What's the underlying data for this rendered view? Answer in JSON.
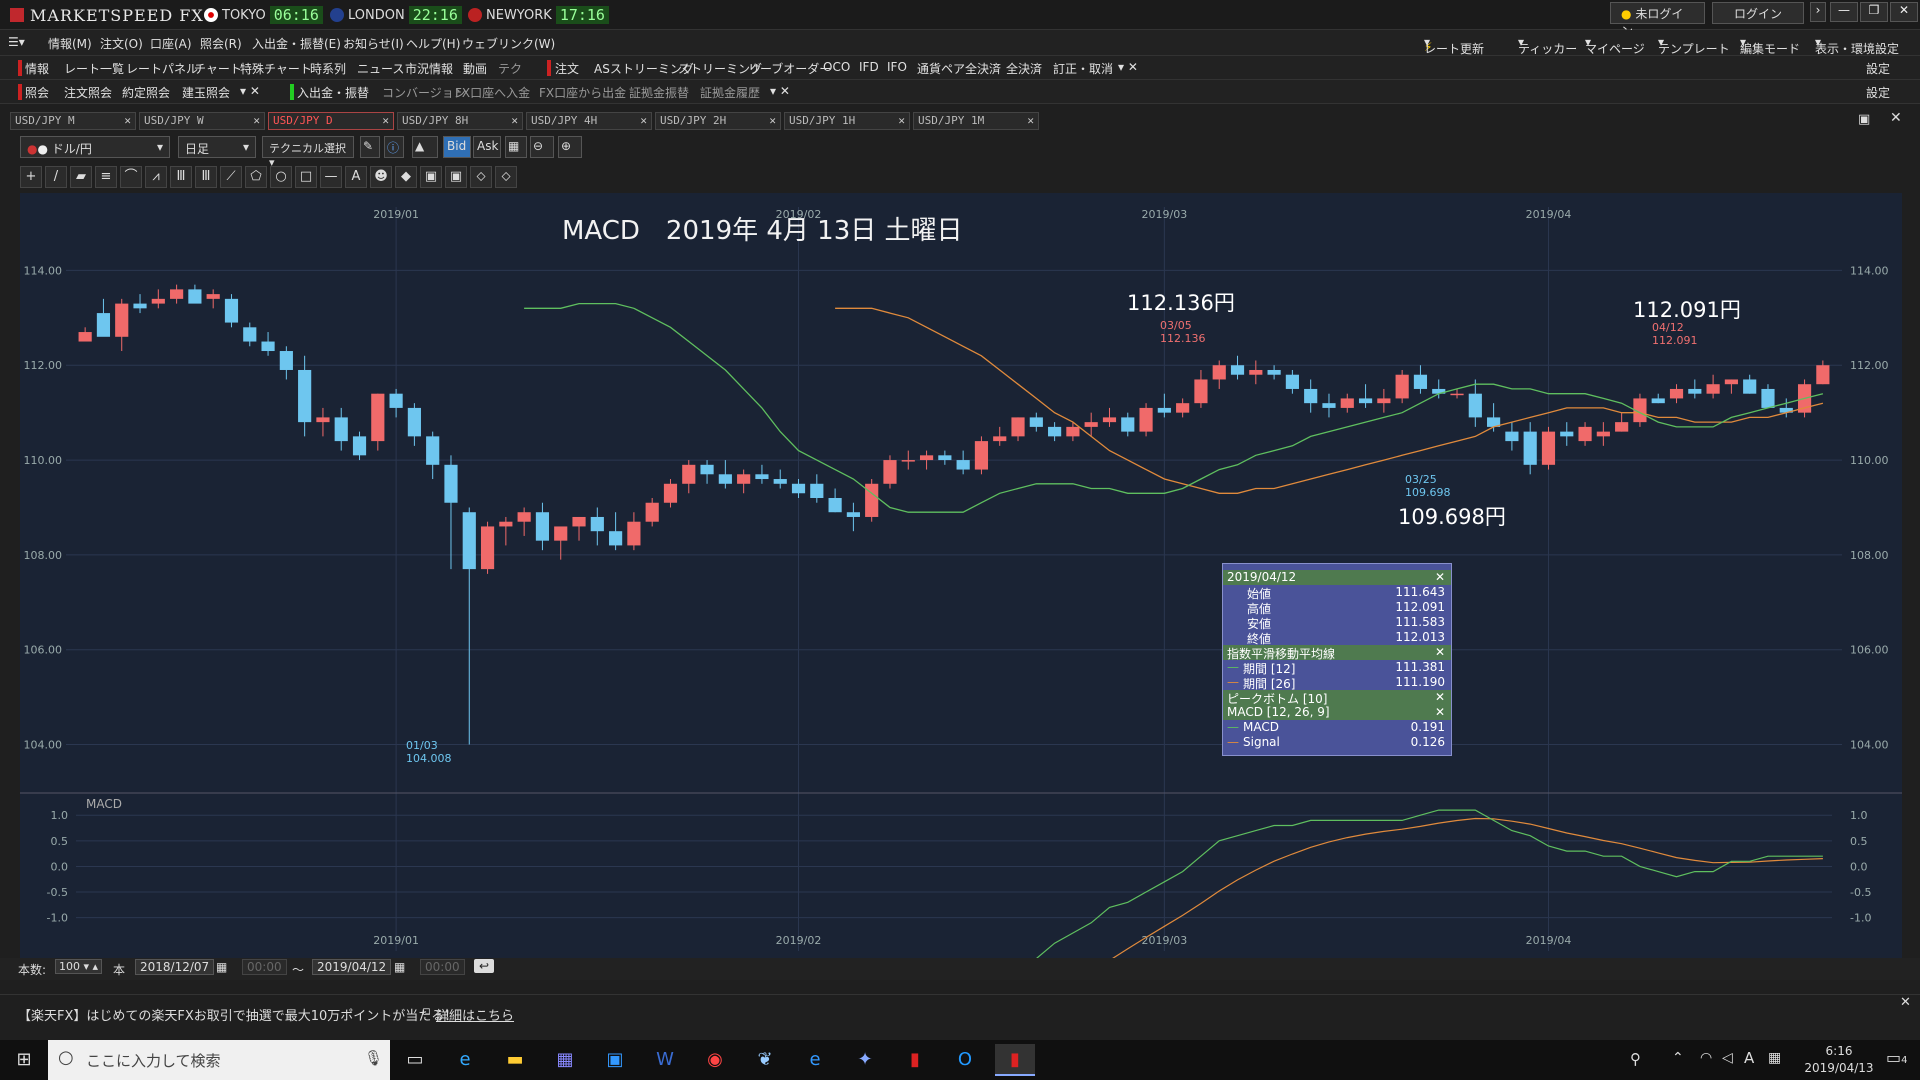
{
  "app": {
    "brand": "MARKETSPEED FX",
    "login_status": "未ログイン",
    "login_button": "ログイン"
  },
  "clocks": [
    {
      "city": "TOKYO",
      "time": "06:16"
    },
    {
      "city": "LONDON",
      "time": "22:16"
    },
    {
      "city": "NEWYORK",
      "time": "17:16"
    }
  ],
  "menubar": [
    "情報(M)",
    "注文(O)",
    "口座(A)",
    "照会(R)",
    "入出金・振替(E)",
    "お知らせ(I)",
    "ヘルプ(H)",
    "ウェブリンク(W)"
  ],
  "menubar_right": [
    "レート更新",
    "ティッカー",
    "マイページ",
    "テンプレート",
    "編集モード",
    "表示・環境設定"
  ],
  "toolbar1": [
    "情報",
    "レート一覧",
    "レートパネル",
    "チャート",
    "特殊チャート",
    "時系列",
    "ニュース",
    "市況情報",
    "動画",
    "テク",
    "注文",
    "ASストリーミング",
    "ストリーミング",
    "リーブオーダー",
    "OCO",
    "IFD",
    "IFO",
    "通貨ペア全決済",
    "全決済",
    "訂正・取消"
  ],
  "toolbar1_right": "設定",
  "toolbar2": [
    "照会",
    "注文照会",
    "約定照会",
    "建玉照会",
    "入出金・振替",
    "コンバージョン",
    "FX口座へ入金",
    "FX口座から出金",
    "証拠金振替",
    "証拠金履歴"
  ],
  "toolbar2_right": "設定",
  "tabs": [
    "USD/JPY M",
    "USD/JPY W",
    "USD/JPY D",
    "USD/JPY 8H",
    "USD/JPY 4H",
    "USD/JPY 2H",
    "USD/JPY 1H",
    "USD/JPY 1M"
  ],
  "active_tab": 2,
  "controls": {
    "pair": "ドル/円",
    "period": "日足",
    "technical": "テクニカル選択",
    "bid": "Bid",
    "ask": "Ask"
  },
  "overlay_title": "MACD　2019年 4月 13日 土曜日",
  "annotations": {
    "high": {
      "price": "112.136円",
      "date": "03/05",
      "value": "112.136"
    },
    "last": {
      "price": "112.091円",
      "date": "04/12",
      "value": "112.091"
    },
    "low_mar": {
      "price": "109.698円",
      "date": "03/25",
      "value": "109.698"
    },
    "low_jan": {
      "date": "01/03",
      "value": "104.008"
    }
  },
  "info_box": {
    "date": "2019/04/12",
    "ohlc": [
      {
        "label": "始値",
        "value": "111.643"
      },
      {
        "label": "高値",
        "value": "112.091"
      },
      {
        "label": "安値",
        "value": "111.583"
      },
      {
        "label": "終値",
        "value": "112.013"
      }
    ],
    "ema_title": "指数平滑移動平均線",
    "ema": [
      {
        "label": "期間 [12]",
        "value": "111.381"
      },
      {
        "label": "期間 [26]",
        "value": "111.190"
      }
    ],
    "peak_title": "ピークボトム [10]",
    "macd_title": "MACD [12, 26, 9]",
    "macd": [
      {
        "label": "MACD",
        "value": "0.191"
      },
      {
        "label": "Signal",
        "value": "0.126"
      }
    ]
  },
  "macd_label": "MACD",
  "status": {
    "count_label": "本数:",
    "count": "100",
    "unit": "本",
    "from": "2018/12/07",
    "time1": "00:00",
    "tilde": "～",
    "to": "2019/04/12",
    "time2": "00:00"
  },
  "ad": {
    "text": "【楽天FX】はじめての楽天FXお取引で抽選で最大10万ポイントが当たる！",
    "link": "詳細はこちら"
  },
  "taskbar": {
    "search": "ここに入力して検索",
    "time": "6:16",
    "date": "2019/04/13",
    "notif": "4"
  },
  "colors": {
    "up": "#f06a6a",
    "down": "#6ec6ef",
    "ema12": "#5fbf5f",
    "ema26": "#e08a3c",
    "bg": "#1a2334"
  },
  "chart_data": {
    "type": "candlestick",
    "ylim": [
      103.4,
      115.0
    ],
    "yticks": [
      "114.00",
      "112.00",
      "110.00",
      "108.00",
      "106.00",
      "104.00"
    ],
    "xticks": [
      {
        "label": "2019/01",
        "index": 17
      },
      {
        "label": "2019/02",
        "index": 39
      },
      {
        "label": "2019/03",
        "index": 59
      },
      {
        "label": "2019/04",
        "index": 80
      }
    ],
    "candles": [
      [
        112.5,
        112.8,
        112.6,
        112.7
      ],
      [
        113.1,
        113.4,
        113.0,
        112.6
      ],
      [
        112.6,
        113.4,
        112.3,
        113.3
      ],
      [
        113.3,
        113.5,
        113.1,
        113.2
      ],
      [
        113.3,
        113.6,
        113.2,
        113.4
      ],
      [
        113.4,
        113.7,
        113.3,
        113.6
      ],
      [
        113.6,
        113.7,
        113.4,
        113.3
      ],
      [
        113.4,
        113.6,
        113.2,
        113.5
      ],
      [
        113.4,
        113.5,
        112.8,
        112.9
      ],
      [
        112.8,
        112.9,
        112.4,
        112.5
      ],
      [
        112.5,
        112.7,
        112.2,
        112.3
      ],
      [
        112.3,
        112.4,
        111.7,
        111.9
      ],
      [
        111.9,
        112.2,
        110.5,
        110.8
      ],
      [
        110.8,
        111.1,
        110.5,
        110.9
      ],
      [
        110.9,
        111.1,
        110.2,
        110.4
      ],
      [
        110.5,
        110.6,
        110.0,
        110.1
      ],
      [
        110.4,
        111.4,
        110.2,
        111.4
      ],
      [
        111.4,
        111.5,
        110.9,
        111.1
      ],
      [
        111.1,
        111.2,
        110.3,
        110.5
      ],
      [
        110.5,
        110.6,
        109.6,
        109.9
      ],
      [
        109.9,
        110.1,
        107.7,
        109.1
      ],
      [
        108.9,
        109.0,
        104.0,
        107.7
      ],
      [
        107.7,
        108.7,
        107.6,
        108.6
      ],
      [
        108.6,
        108.8,
        108.2,
        108.7
      ],
      [
        108.7,
        109.0,
        108.4,
        108.9
      ],
      [
        108.9,
        109.1,
        108.1,
        108.3
      ],
      [
        108.3,
        108.5,
        107.9,
        108.6
      ],
      [
        108.6,
        108.8,
        108.3,
        108.8
      ],
      [
        108.8,
        109.0,
        108.2,
        108.5
      ],
      [
        108.5,
        108.9,
        108.1,
        108.2
      ],
      [
        108.2,
        108.9,
        108.1,
        108.7
      ],
      [
        108.7,
        109.2,
        108.6,
        109.1
      ],
      [
        109.1,
        109.6,
        109.0,
        109.5
      ],
      [
        109.5,
        110.0,
        109.3,
        109.9
      ],
      [
        109.9,
        110.0,
        109.5,
        109.7
      ],
      [
        109.7,
        110.0,
        109.4,
        109.5
      ],
      [
        109.5,
        109.8,
        109.3,
        109.7
      ],
      [
        109.7,
        109.9,
        109.5,
        109.6
      ],
      [
        109.6,
        109.8,
        109.4,
        109.5
      ],
      [
        109.5,
        109.6,
        109.2,
        109.3
      ],
      [
        109.5,
        109.7,
        109.1,
        109.2
      ],
      [
        109.2,
        109.4,
        108.9,
        108.9
      ],
      [
        108.9,
        109.1,
        108.5,
        108.8
      ],
      [
        108.8,
        109.6,
        108.7,
        109.5
      ],
      [
        109.5,
        110.1,
        109.4,
        110.0
      ],
      [
        110.0,
        110.2,
        109.8,
        110.0
      ],
      [
        110.0,
        110.2,
        109.8,
        110.1
      ],
      [
        110.1,
        110.2,
        109.9,
        110.0
      ],
      [
        110.0,
        110.2,
        109.7,
        109.8
      ],
      [
        109.8,
        110.5,
        109.7,
        110.4
      ],
      [
        110.4,
        110.7,
        110.3,
        110.5
      ],
      [
        110.5,
        110.9,
        110.4,
        110.9
      ],
      [
        110.9,
        111.0,
        110.6,
        110.7
      ],
      [
        110.7,
        110.8,
        110.4,
        110.5
      ],
      [
        110.5,
        110.8,
        110.4,
        110.7
      ],
      [
        110.7,
        111.0,
        110.5,
        110.8
      ],
      [
        110.8,
        111.1,
        110.7,
        110.9
      ],
      [
        110.9,
        111.0,
        110.5,
        110.6
      ],
      [
        110.6,
        111.2,
        110.5,
        111.1
      ],
      [
        111.1,
        111.4,
        110.9,
        111.0
      ],
      [
        111.0,
        111.3,
        110.9,
        111.2
      ],
      [
        111.2,
        111.9,
        111.1,
        111.7
      ],
      [
        111.7,
        112.1,
        111.5,
        112.0
      ],
      [
        112.0,
        112.2,
        111.7,
        111.8
      ],
      [
        111.8,
        112.1,
        111.6,
        111.9
      ],
      [
        111.9,
        112.0,
        111.7,
        111.8
      ],
      [
        111.8,
        111.9,
        111.4,
        111.5
      ],
      [
        111.5,
        111.7,
        111.0,
        111.2
      ],
      [
        111.2,
        111.4,
        110.9,
        111.1
      ],
      [
        111.1,
        111.4,
        111.0,
        111.3
      ],
      [
        111.3,
        111.6,
        111.1,
        111.2
      ],
      [
        111.2,
        111.5,
        111.0,
        111.3
      ],
      [
        111.3,
        111.9,
        111.2,
        111.8
      ],
      [
        111.8,
        112.0,
        111.4,
        111.5
      ],
      [
        111.5,
        111.7,
        111.3,
        111.4
      ],
      [
        111.4,
        111.5,
        111.3,
        111.4
      ],
      [
        111.4,
        111.7,
        110.7,
        110.9
      ],
      [
        110.9,
        111.2,
        110.6,
        110.7
      ],
      [
        110.6,
        110.8,
        110.2,
        110.4
      ],
      [
        110.6,
        110.8,
        109.7,
        109.9
      ],
      [
        109.9,
        110.7,
        109.8,
        110.6
      ],
      [
        110.6,
        110.8,
        110.3,
        110.5
      ],
      [
        110.4,
        110.8,
        110.3,
        110.7
      ],
      [
        110.5,
        110.8,
        110.3,
        110.6
      ],
      [
        110.6,
        111.0,
        110.6,
        110.8
      ],
      [
        110.8,
        111.4,
        110.7,
        111.3
      ],
      [
        111.3,
        111.4,
        111.2,
        111.2
      ],
      [
        111.3,
        111.6,
        111.2,
        111.5
      ],
      [
        111.5,
        111.7,
        111.3,
        111.4
      ],
      [
        111.4,
        111.8,
        111.3,
        111.6
      ],
      [
        111.6,
        111.7,
        111.4,
        111.7
      ],
      [
        111.7,
        111.8,
        111.4,
        111.4
      ],
      [
        111.5,
        111.6,
        111.1,
        111.1
      ],
      [
        111.1,
        111.3,
        110.9,
        111.0
      ],
      [
        111.0,
        111.7,
        110.9,
        111.6
      ],
      [
        111.6,
        112.1,
        111.6,
        112.0
      ]
    ],
    "ema12": [
      113.2,
      113.2,
      113.2,
      113.3,
      113.3,
      113.3,
      113.2,
      113.0,
      112.8,
      112.5,
      112.2,
      111.9,
      111.5,
      111.1,
      110.6,
      110.2,
      110.0,
      109.8,
      109.6,
      109.3,
      109.0,
      108.9,
      108.9,
      108.9,
      108.9,
      109.1,
      109.3,
      109.4,
      109.5,
      109.5,
      109.5,
      109.4,
      109.4,
      109.3,
      109.3,
      109.3,
      109.4,
      109.6,
      109.8,
      109.9,
      110.1,
      110.2,
      110.3,
      110.5,
      110.6,
      110.7,
      110.8,
      110.9,
      111.0,
      111.2,
      111.4,
      111.5,
      111.6,
      111.6,
      111.5,
      111.5,
      111.4,
      111.4,
      111.4,
      111.3,
      111.2,
      111.0,
      110.8,
      110.7,
      110.7,
      110.7,
      110.9,
      111.0,
      111.1,
      111.2,
      111.3,
      111.4
    ],
    "ema26": [
      113.2,
      113.2,
      113.2,
      113.1,
      113.0,
      112.8,
      112.6,
      112.4,
      112.2,
      111.9,
      111.6,
      111.3,
      111.0,
      110.8,
      110.5,
      110.2,
      110.0,
      109.8,
      109.6,
      109.5,
      109.4,
      109.3,
      109.3,
      109.4,
      109.4,
      109.5,
      109.6,
      109.7,
      109.8,
      109.9,
      110.0,
      110.1,
      110.2,
      110.3,
      110.4,
      110.5,
      110.7,
      110.8,
      110.9,
      111.0,
      111.1,
      111.1,
      111.1,
      111.0,
      111.0,
      110.9,
      110.9,
      110.8,
      110.8,
      110.8,
      110.9,
      110.9,
      111.0,
      111.1,
      111.2
    ],
    "macd_ylim": [
      -1.3,
      1.2
    ],
    "macd_yticks": [
      "1.0",
      "0.5",
      "0.0",
      "-0.5",
      "-1.0"
    ]
  }
}
